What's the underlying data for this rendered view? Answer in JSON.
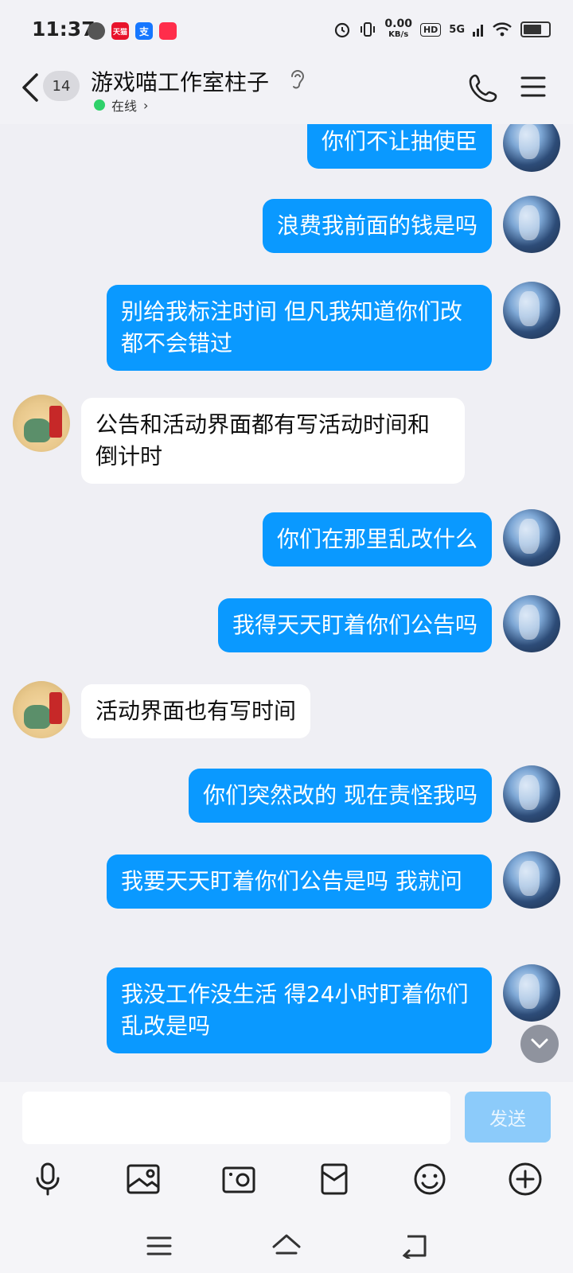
{
  "status_bar": {
    "time": "11:37",
    "apps": [
      {
        "name": "message-app-icon",
        "label": "",
        "color": "#555"
      },
      {
        "name": "tmall-app-icon",
        "label": "天猫",
        "color": "#e8132b"
      },
      {
        "name": "alipay-app-icon",
        "label": "支",
        "color": "#1677ff"
      },
      {
        "name": "red-app-icon",
        "label": "",
        "color": "#ff2d4b"
      }
    ],
    "net_speed": "0.00",
    "net_unit": "KB/s",
    "hd": "HD",
    "signal": "5G",
    "battery_level": 0.85
  },
  "header": {
    "unread_count": "14",
    "title": "游戏喵工作室柱子",
    "status": "在线",
    "status_arrow": "›"
  },
  "messages": [
    {
      "side": "me",
      "text": "你们不让抽使臣"
    },
    {
      "side": "me",
      "text": "浪费我前面的钱是吗"
    },
    {
      "side": "me",
      "text": "别给我标注时间 但凡我知道你们改都不会错过"
    },
    {
      "side": "other",
      "text": "公告和活动界面都有写活动时间和倒计时"
    },
    {
      "side": "me",
      "text": "你们在那里乱改什么"
    },
    {
      "side": "me",
      "text": "我得天天盯着你们公告吗"
    },
    {
      "side": "other",
      "text": "活动界面也有写时间"
    },
    {
      "side": "me",
      "text": "你们突然改的 现在责怪我吗"
    },
    {
      "side": "me",
      "text": "我要天天盯着你们公告是吗 我就问"
    },
    {
      "side": "me",
      "text": "我没工作没生活 得24小时盯着你们乱改是吗"
    }
  ],
  "composer": {
    "input_value": "",
    "send_label": "发送"
  },
  "toolbar": [
    "mic-icon",
    "image-icon",
    "camera-icon",
    "red-packet-icon",
    "emoji-icon",
    "plus-icon"
  ],
  "navigation": [
    "menu-icon",
    "home-icon",
    "back-icon"
  ],
  "colors": {
    "my_bubble": "#0a99ff",
    "other_bubble": "#ffffff",
    "online_dot": "#2fd16a",
    "send_button": "#8ccbfa"
  }
}
